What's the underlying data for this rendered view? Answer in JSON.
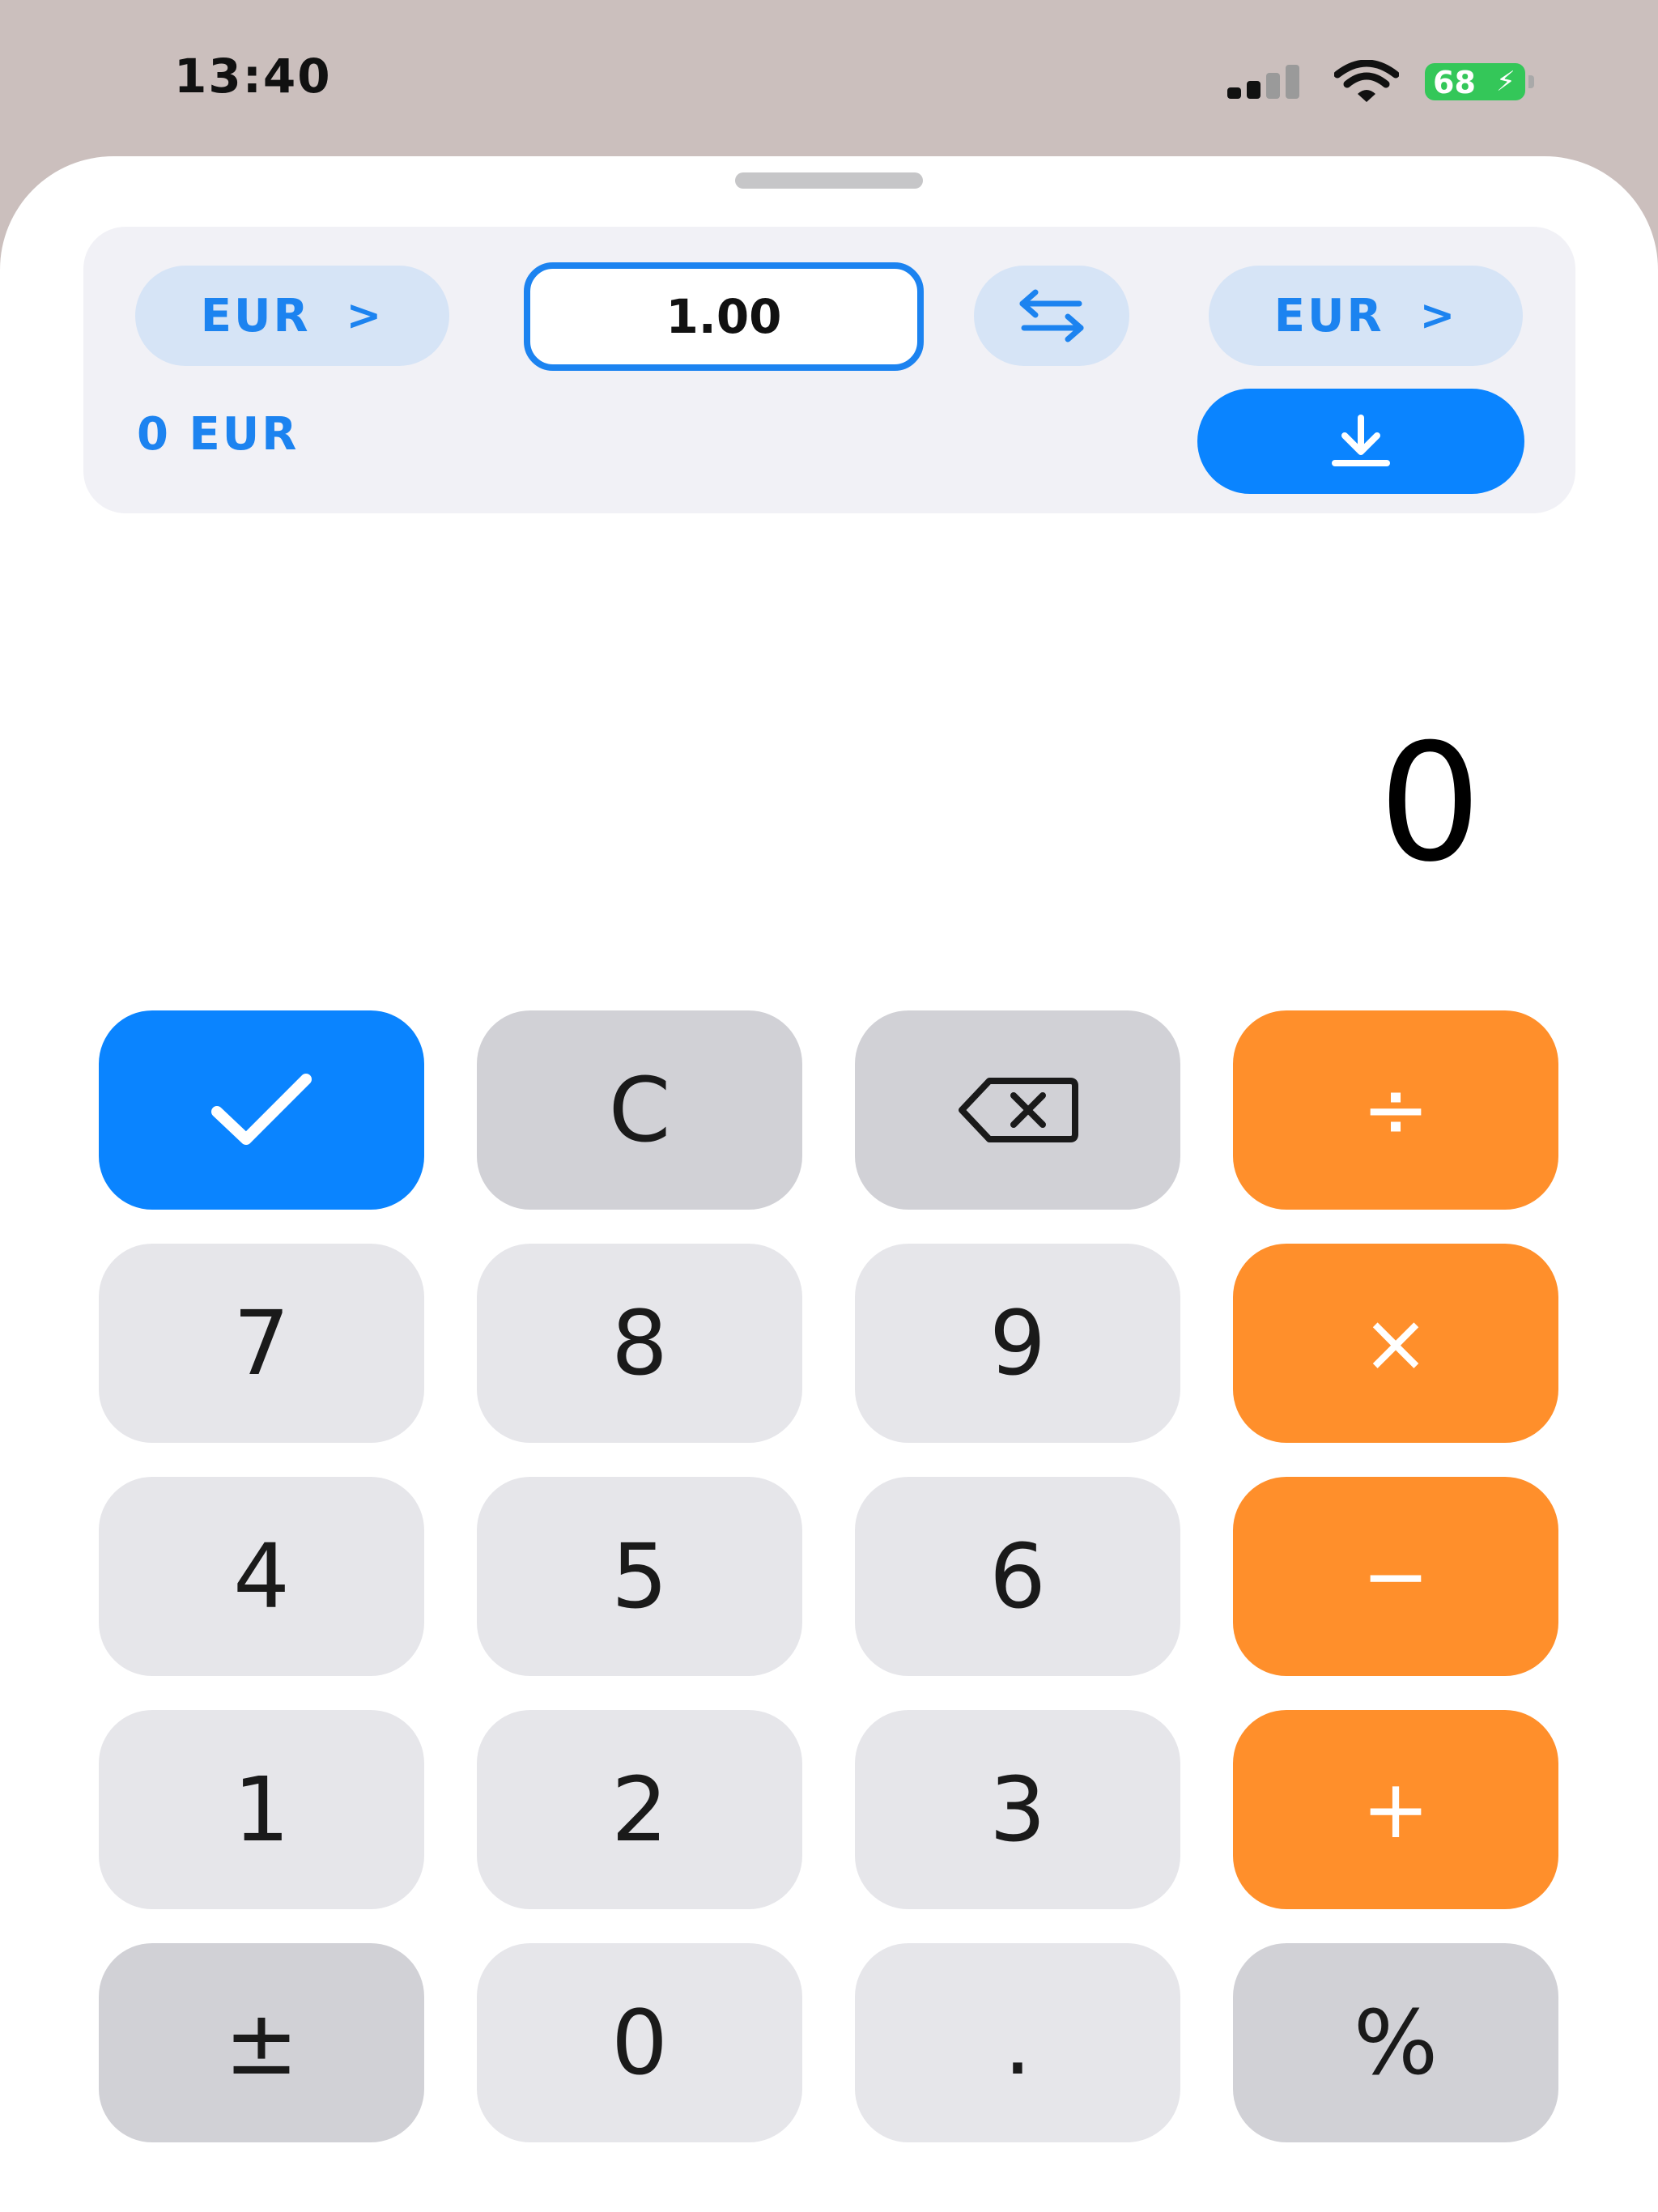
{
  "status_bar": {
    "time": "13:40",
    "battery_level": "68",
    "icons": [
      "signal-icon",
      "wifi-icon",
      "battery-charging-icon"
    ]
  },
  "converter": {
    "from_currency": "EUR",
    "to_currency": "EUR",
    "amount": "1.00",
    "converted": "0 EUR",
    "icons": [
      "chevron-right-icon",
      "swap-arrows-icon",
      "download-arrow-icon"
    ]
  },
  "display": {
    "value": "0"
  },
  "keypad": {
    "row1": [
      "✓",
      "C",
      "⌫",
      "÷"
    ],
    "row2": [
      "7",
      "8",
      "9",
      "×"
    ],
    "row3": [
      "4",
      "5",
      "6",
      "−"
    ],
    "row4": [
      "1",
      "2",
      "3",
      "+"
    ],
    "row5": [
      "±",
      "0",
      ".",
      "%"
    ]
  },
  "colors": {
    "accent_blue": "#0a84ff",
    "operator_orange": "#ff8f2b",
    "number_key": "#e6e6ea",
    "function_key": "#d1d1d6",
    "pill_bg": "#d6e4f6",
    "battery_green": "#34c759"
  }
}
